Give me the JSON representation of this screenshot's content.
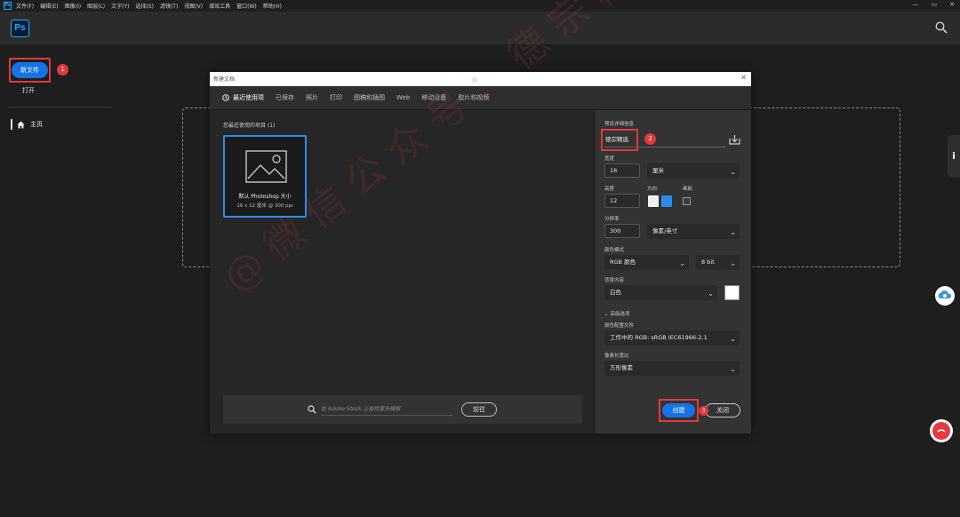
{
  "menubar": {
    "app_icon": "Ps",
    "items": [
      "文件(F)",
      "编辑(E)",
      "图像(I)",
      "图层(L)",
      "文字(Y)",
      "选择(S)",
      "滤镜(T)",
      "视图(V)",
      "增效工具",
      "窗口(W)",
      "帮助(H)"
    ],
    "window_controls": [
      "—",
      "▭",
      "✕"
    ]
  },
  "header": {
    "logo": "Ps",
    "search_icon": "search-icon"
  },
  "sidebar": {
    "new_file": "新文件",
    "open": "打开",
    "home": "主页",
    "badge_1": "1"
  },
  "dialog": {
    "title": "新建文档",
    "close": "✕",
    "tabs": [
      "最近使用项",
      "已保存",
      "照片",
      "打印",
      "图稿和插图",
      "Web",
      "移动设备",
      "胶片和视频"
    ],
    "recent_label": "您最近使用的项目 (1)",
    "preset": {
      "name": "默认 Photoshop 大小",
      "size": "16 x 12 厘米 @ 300 ppi"
    },
    "stock": {
      "placeholder": "在 Adobe Stock 上查找更多模板",
      "goto": "前往"
    },
    "details": {
      "section_title": "预设详细信息",
      "preset_name": "德宗精选",
      "badge_2": "2",
      "width_label": "宽度",
      "width_value": "16",
      "width_unit": "厘米",
      "height_label": "高度",
      "height_value": "12",
      "orientation_label": "方向",
      "artboard_label": "画板",
      "resolution_label": "分辨率",
      "resolution_value": "300",
      "resolution_unit": "像素/英寸",
      "color_mode_label": "颜色模式",
      "color_mode": "RGB 颜色",
      "bit_depth": "8 bit",
      "bg_label": "背景内容",
      "bg_value": "白色",
      "advanced": "高级选项",
      "profile_label": "颜色配置文件",
      "profile_value": "工作中的 RGB: sRGB IEC61966-2.1",
      "pixel_aspect_label": "像素长宽比",
      "pixel_aspect_value": "方形像素",
      "create": "创建",
      "badge_3": "3",
      "close_btn": "关闭"
    }
  },
  "right_edge": {
    "info": "i"
  },
  "watermark": "@微信公众号：德宗精选",
  "colors": {
    "accent": "#1473e6",
    "highlight": "#e23a3a",
    "badge": "#e0393e"
  }
}
